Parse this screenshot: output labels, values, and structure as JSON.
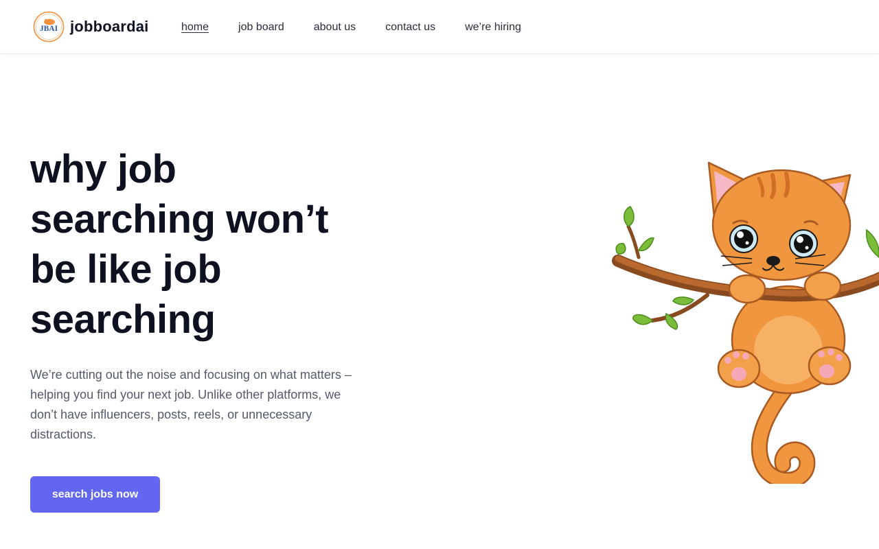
{
  "brand": {
    "name": "jobboardai",
    "logo_text": "JBAI",
    "logo_color": "#f3923f",
    "logo_text_color": "#2a55a8"
  },
  "nav": {
    "items": [
      {
        "label": "home",
        "active": true
      },
      {
        "label": "job board",
        "active": false
      },
      {
        "label": "about us",
        "active": false
      },
      {
        "label": "contact us",
        "active": false
      },
      {
        "label": "we’re hiring",
        "active": false
      }
    ]
  },
  "hero": {
    "title_lines": [
      "why job",
      "searching won’t",
      "be like job",
      "searching"
    ],
    "description": "We’re cutting out the noise and focusing on what matters – helping you find your next job. Unlike other platforms, we don’t have influencers, posts, reels, or unnecessary distractions.",
    "cta_label": "search jobs now",
    "cta_color": "#6366f1",
    "illustration": "cat-on-branch-illustration"
  }
}
